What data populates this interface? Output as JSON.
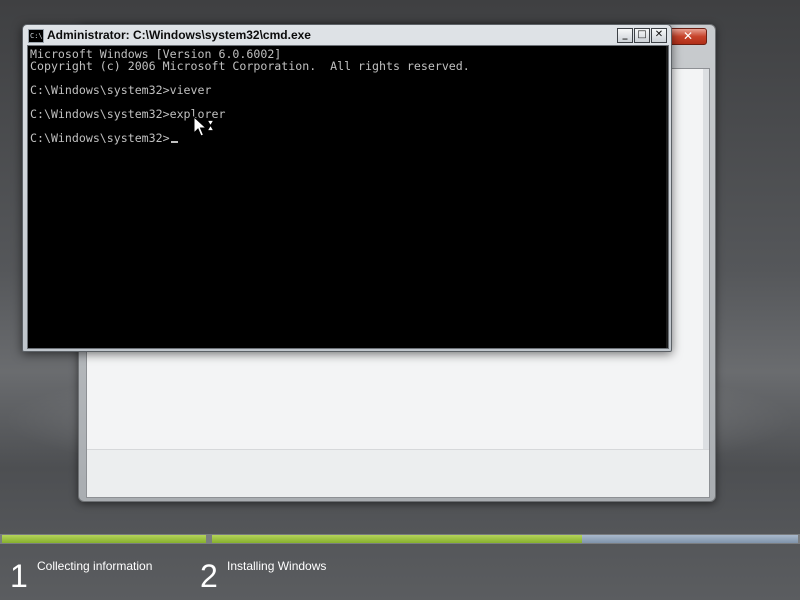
{
  "setup_window": {
    "close_glyph": "✕"
  },
  "cmd_window": {
    "title": "Administrator: C:\\Windows\\system32\\cmd.exe",
    "icon_text": "C:\\",
    "controls": {
      "minimize": "_",
      "maximize": "□",
      "close": "✕"
    },
    "lines": [
      "Microsoft Windows [Version 6.0.6002]",
      "Copyright (c) 2006 Microsoft Corporation.  All rights reserved.",
      "",
      "C:\\Windows\\system32>viever",
      "",
      "C:\\Windows\\system32>explorer",
      "",
      "C:\\Windows\\system32>"
    ]
  },
  "setup_progress": {
    "steps": [
      {
        "number": "1",
        "label": "Collecting information"
      },
      {
        "number": "2",
        "label": "Installing Windows"
      }
    ]
  },
  "colors": {
    "console_bg": "#000000",
    "console_text": "#C0C0C0",
    "progress_done": "#9BC23A",
    "progress_remaining": "#8FA3BA"
  },
  "icons": [
    "cmd-icon",
    "minimize-icon",
    "maximize-icon",
    "close-icon",
    "mouse-pointer-icon",
    "hourglass-icon"
  ]
}
